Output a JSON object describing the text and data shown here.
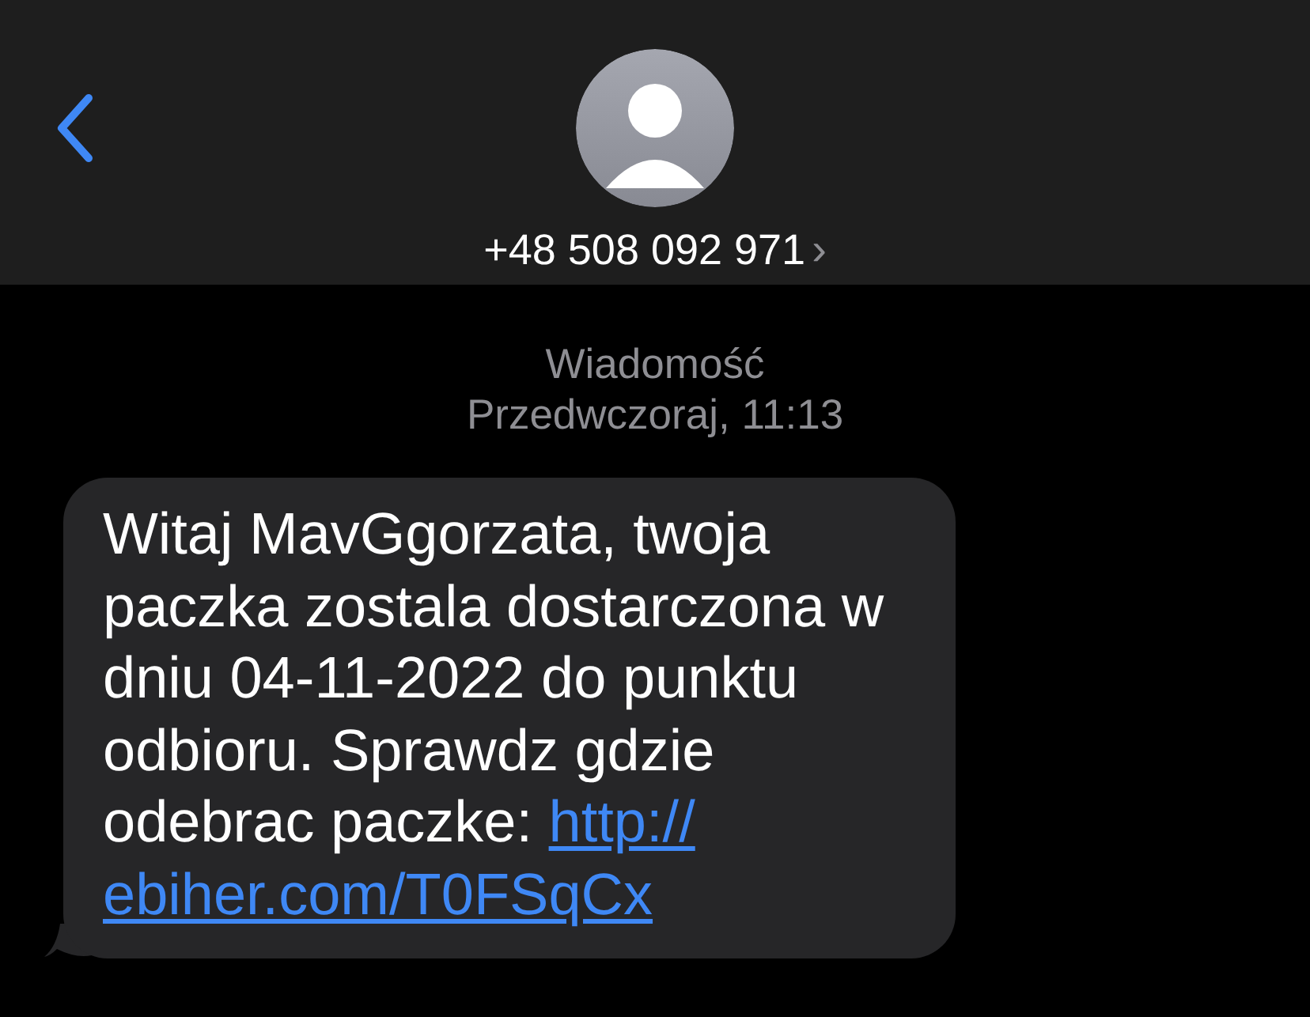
{
  "header": {
    "contact": "+48 508 092 971",
    "chevron": "›"
  },
  "conversation": {
    "service": "Wiadomość",
    "timestamp": "Przedwczoraj, 11:13"
  },
  "message": {
    "text": "Witaj MavGgorzata, twoja paczka zostala dostarczona w dniu 04-11-2022 do punktu odbioru. Sprawdz gdzie odebrac paczke: ",
    "link_lines": [
      "http://",
      "ebiher.com/T0FSqCx"
    ]
  }
}
